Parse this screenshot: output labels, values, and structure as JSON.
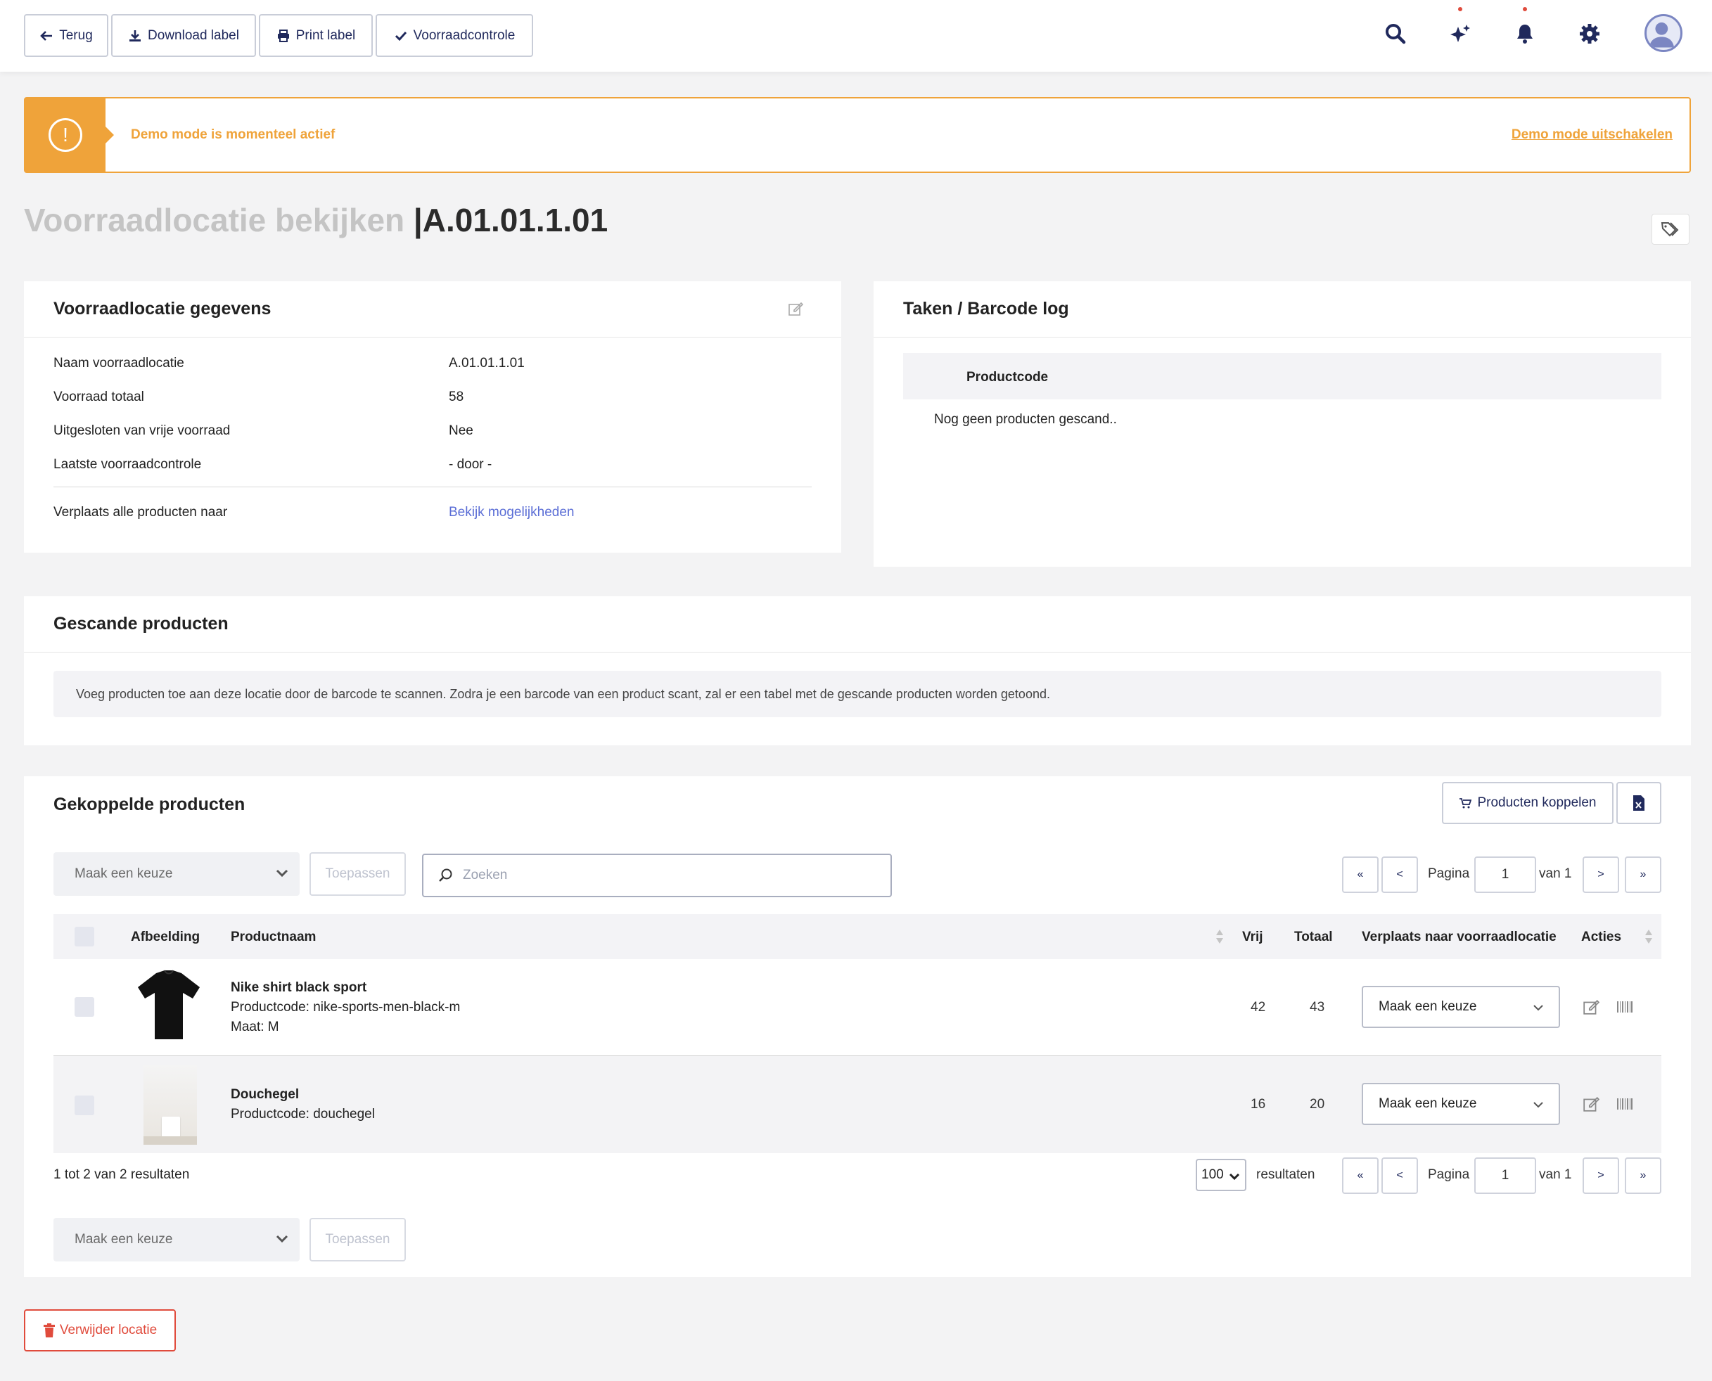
{
  "toolbar": {
    "back_label": "Terug",
    "download_label": "Download label",
    "print_label": "Print label",
    "stockcheck_label": "Voorraadcontrole",
    "icons": [
      "search-icon",
      "sparkles-icon",
      "bell-icon",
      "gear-icon",
      "user-avatar"
    ]
  },
  "alert": {
    "message": "Demo mode is momenteel actief",
    "action": "Demo mode uitschakelen",
    "icon": "!",
    "color": "#efa33a"
  },
  "page": {
    "title_light": "Voorraadlocatie bekijken",
    "title_sep": "|",
    "title_code": "A.01.01.1.01"
  },
  "location_card": {
    "title": "Voorraadlocatie gegevens",
    "rows": [
      {
        "label": "Naam voorraadlocatie",
        "value": "A.01.01.1.01"
      },
      {
        "label": "Voorraad totaal",
        "value": "58"
      },
      {
        "label": "Uitgesloten van vrije voorraad",
        "value": "Nee"
      },
      {
        "label": "Laatste voorraadcontrole",
        "value": "- door -"
      }
    ],
    "move_label": "Verplaats alle producten naar",
    "move_link": "Bekijk mogelijkheden"
  },
  "tasks_card": {
    "title": "Taken / Barcode log",
    "column": "Productcode",
    "empty": "Nog geen producten gescand.."
  },
  "scanned_card": {
    "title": "Gescande producten",
    "info": "Voeg producten toe aan deze locatie door de barcode te scannen. Zodra je een barcode van een product scant, zal er een tabel met de gescande producten worden getoond."
  },
  "linked_card": {
    "title": "Gekoppelde producten",
    "link_button": "Producten koppelen",
    "bulk_select": "Maak een keuze",
    "apply": "Toepassen",
    "search_placeholder": "Zoeken",
    "pagination": {
      "first": "«",
      "prev": "<",
      "next": ">",
      "last": "»",
      "page_label": "Pagina",
      "page": "1",
      "of_label": "van 1"
    },
    "columns": {
      "image": "Afbeelding",
      "name": "Productnaam",
      "free": "Vrij",
      "total": "Totaal",
      "move": "Verplaats naar voorraadlocatie",
      "actions": "Acties"
    },
    "rows": [
      {
        "name": "Nike shirt black sport",
        "code": "Productcode: nike-sports-men-black-m",
        "size": "Maat: M",
        "free": "42",
        "total": "43",
        "move": "Maak een keuze"
      },
      {
        "name": "Douchegel",
        "code": "Productcode: douchegel",
        "free": "16",
        "total": "20",
        "move": "Maak een keuze"
      }
    ],
    "results_text": "1 tot 2 van 2 resultaten",
    "per_page": "100",
    "results_label": "resultaten"
  },
  "delete_button": "Verwijder locatie",
  "colors": {
    "accent": "#efa33a",
    "navy": "#20295c",
    "danger": "#e04b3c",
    "link": "#5b6ed6"
  }
}
